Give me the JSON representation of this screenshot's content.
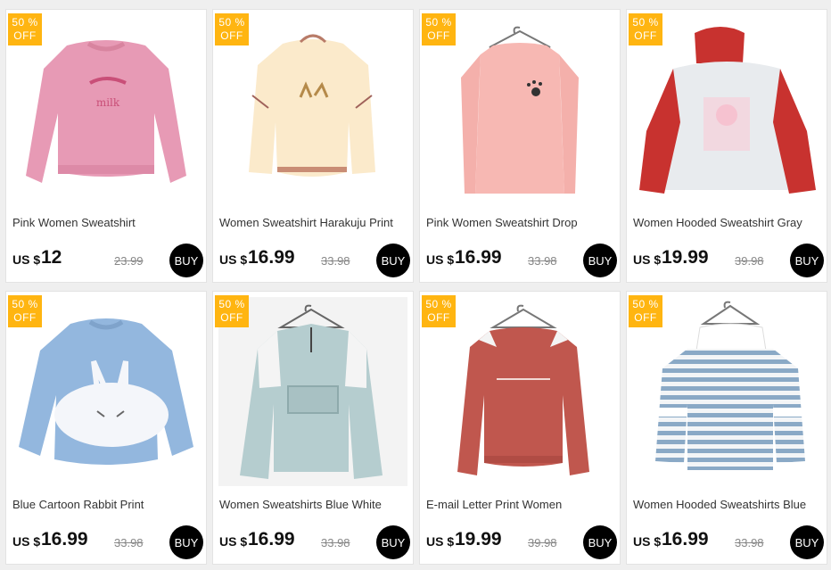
{
  "badge": {
    "percent_label": "50 %",
    "off_label": "OFF"
  },
  "currency_label": "US $",
  "buy_label": "BUY",
  "products": [
    {
      "title": "Pink Women Sweatshirt",
      "price": "12",
      "old_price": "23.99",
      "image": "pink-sweatshirt-image"
    },
    {
      "title": "Women Sweatshirt Harakuju Print",
      "price": "16.99",
      "old_price": "33.98",
      "image": "cream-sweatshirt-image"
    },
    {
      "title": "Pink Women Sweatshirt Drop",
      "price": "16.99",
      "old_price": "33.98",
      "image": "pink-cold-shoulder-sweatshirt-image"
    },
    {
      "title": "Women Hooded Sweatshirt Gray",
      "price": "19.99",
      "old_price": "39.98",
      "image": "gray-red-hoodie-image"
    },
    {
      "title": "Blue Cartoon Rabbit Print",
      "price": "16.99",
      "old_price": "33.98",
      "image": "blue-rabbit-sweatshirt-image"
    },
    {
      "title": "Women Sweatshirts Blue White",
      "price": "16.99",
      "old_price": "33.98",
      "image": "blue-white-pullover-image"
    },
    {
      "title": "E-mail Letter Print Women",
      "price": "19.99",
      "old_price": "39.98",
      "image": "rust-letter-sweatshirt-image"
    },
    {
      "title": "Women Hooded Sweatshirts Blue",
      "price": "16.99",
      "old_price": "33.98",
      "image": "blue-striped-hoodie-image"
    }
  ]
}
